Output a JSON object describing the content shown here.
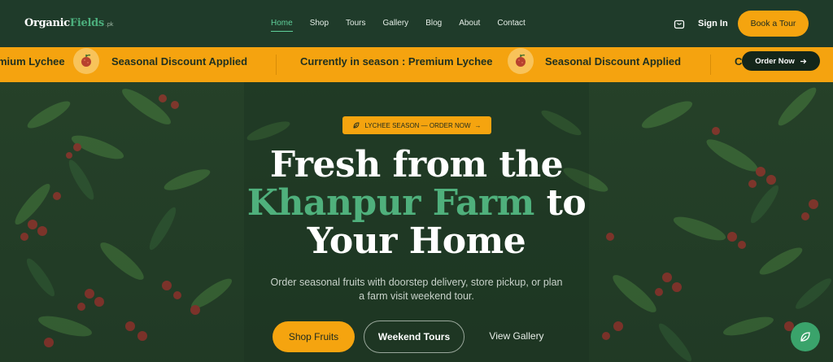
{
  "brand": {
    "name_part1": "Organic",
    "name_part2": "Fields",
    "suffix": ".pk"
  },
  "nav": {
    "items": [
      {
        "label": "Home",
        "active": true
      },
      {
        "label": "Shop"
      },
      {
        "label": "Tours"
      },
      {
        "label": "Gallery"
      },
      {
        "label": "Blog"
      },
      {
        "label": "About"
      },
      {
        "label": "Contact"
      }
    ],
    "cart_icon": "shopping-bag-icon",
    "signin_label": "Sign In",
    "book_label": "Book a Tour"
  },
  "ticker": {
    "items": [
      "mium Lychee",
      "Seasonal Discount Applied",
      "Currently in season : Premium Lychee",
      "Seasonal Discount Applied",
      "C"
    ],
    "fruit_icon": "lychee-icon",
    "order_label": "Order Now",
    "order_icon": "arrow-right-icon"
  },
  "hero": {
    "pill_label": "LYCHEE SEASON — ORDER NOW",
    "pill_arrow": "→",
    "line1": "Fresh from the",
    "line2_accent": "Khanpur Farm",
    "line2_rest": " to",
    "line3": "Your Home",
    "subtitle_line1": "Order seasonal fruits with doorstep delivery, store pickup, or plan",
    "subtitle_line2": "a farm visit weekend tour.",
    "btn_shop": "Shop Fruits",
    "btn_tours": "Weekend Tours",
    "btn_gallery": "View Gallery"
  },
  "colors": {
    "accent": "#f5a40f",
    "green": "#4fb07c",
    "nav_bg": "#1f3b2a"
  }
}
